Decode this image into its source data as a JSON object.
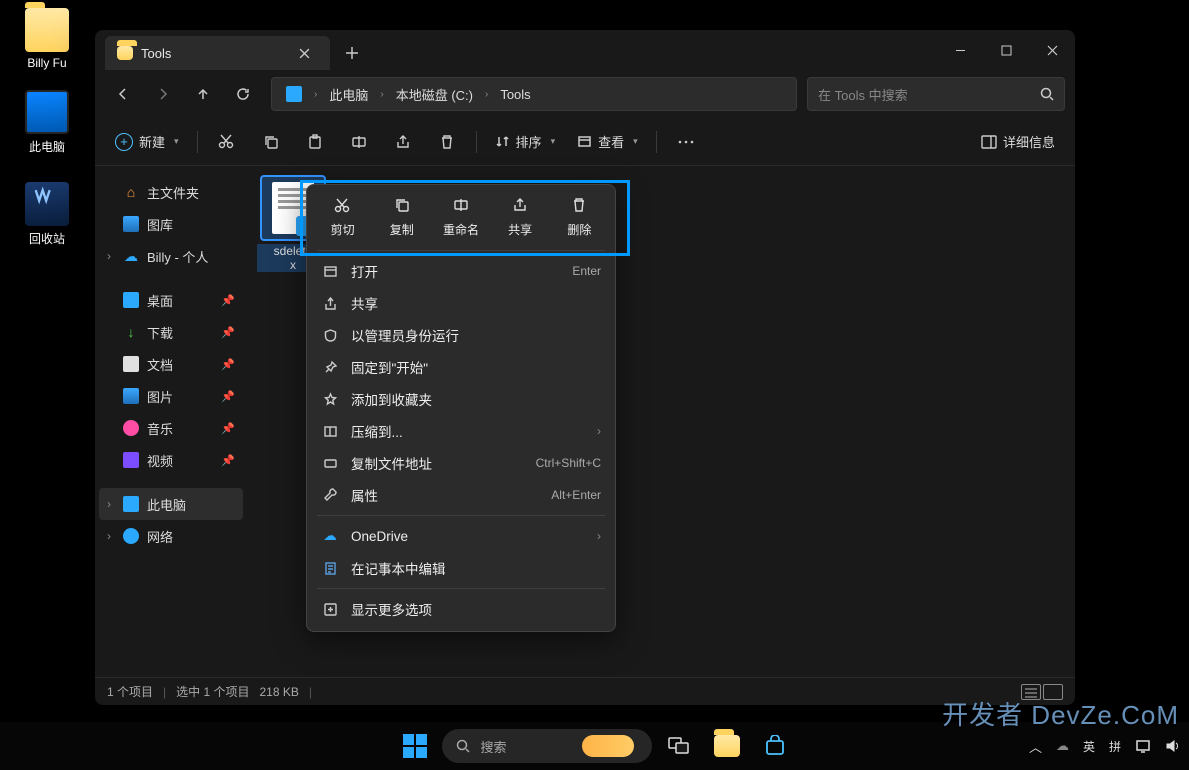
{
  "desktop": {
    "icons": [
      {
        "label": "Billy Fu"
      },
      {
        "label": "此电脑"
      },
      {
        "label": "回收站"
      }
    ]
  },
  "explorer": {
    "tab_title": "Tools",
    "breadcrumb": [
      "此电脑",
      "本地磁盘 (C:)",
      "Tools"
    ],
    "search_placeholder": "在 Tools 中搜索",
    "toolbar": {
      "new": "新建",
      "sort": "排序",
      "view": "查看",
      "details": "详细信息"
    },
    "sidebar": {
      "home": "主文件夹",
      "gallery": "图库",
      "personal": "Billy - 个人",
      "desktop": "桌面",
      "downloads": "下载",
      "documents": "文档",
      "pictures": "图片",
      "music": "音乐",
      "videos": "视频",
      "this_pc": "此电脑",
      "network": "网络"
    },
    "files": [
      {
        "name": "sdelete",
        "second_name": "x"
      }
    ],
    "status": {
      "items": "1 个项目",
      "selected": "选中 1 个项目",
      "size": "218 KB"
    }
  },
  "context_menu": {
    "quick": [
      {
        "label": "剪切"
      },
      {
        "label": "复制"
      },
      {
        "label": "重命名"
      },
      {
        "label": "共享"
      },
      {
        "label": "删除"
      }
    ],
    "items": [
      {
        "label": "打开",
        "shortcut": "Enter",
        "icon": "open"
      },
      {
        "label": "共享",
        "icon": "share"
      },
      {
        "label": "以管理员身份运行",
        "icon": "admin"
      },
      {
        "label": "固定到\"开始\"",
        "icon": "pin"
      },
      {
        "label": "添加到收藏夹",
        "icon": "star"
      },
      {
        "label": "压缩到...",
        "icon": "zip",
        "submenu": true
      },
      {
        "label": "复制文件地址",
        "shortcut": "Ctrl+Shift+C",
        "icon": "path"
      },
      {
        "label": "属性",
        "shortcut": "Alt+Enter",
        "icon": "props"
      }
    ],
    "extra": [
      {
        "label": "OneDrive",
        "icon": "onedrive",
        "submenu": true
      },
      {
        "label": "在记事本中编辑",
        "icon": "notepad"
      }
    ],
    "more": {
      "label": "显示更多选项"
    }
  },
  "taskbar": {
    "search": "搜索",
    "ime": [
      "英",
      "拼"
    ]
  },
  "watermark": "开发者 DevZe.CoM"
}
